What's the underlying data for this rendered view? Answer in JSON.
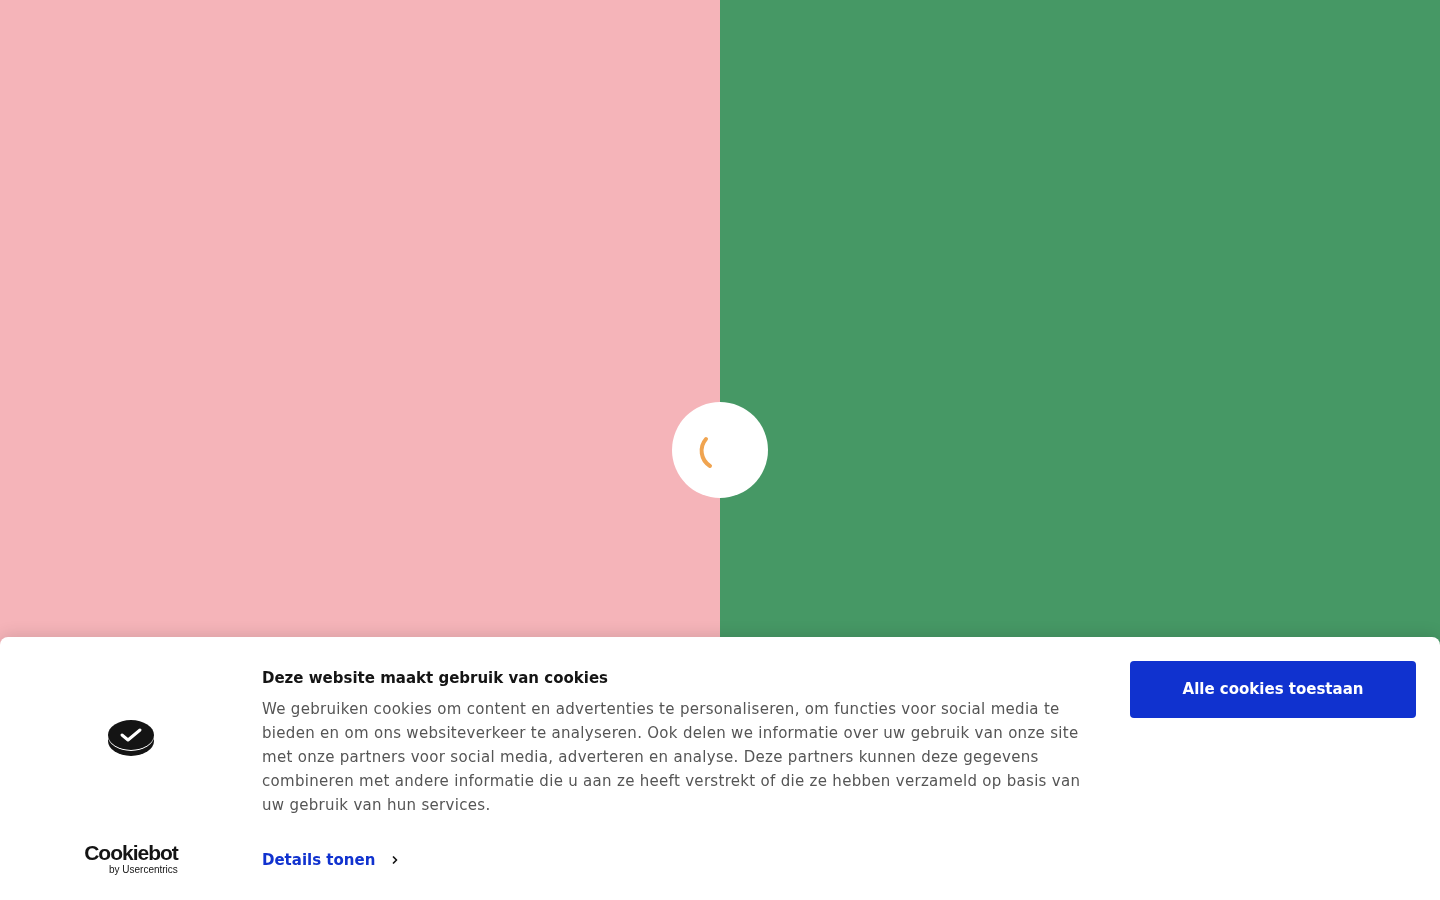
{
  "cookie_banner": {
    "brand": {
      "name": "Cookiebot",
      "byline": "by Usercentrics"
    },
    "title": "Deze website maakt gebruik van cookies",
    "body": "We gebruiken cookies om content en advertenties te personaliseren, om functies voor social media te bieden en om ons websiteverkeer te analyseren. Ook delen we informatie over uw gebruik van onze site met onze partners voor social media, adverteren en analyse. Deze partners kunnen deze gegevens combineren met andere informatie die u aan ze heeft verstrekt of die ze hebben verzameld op basis van uw gebruik van hun services.",
    "details_link": "Details tonen",
    "buttons": [
      "Alle cookies toestaan"
    ]
  }
}
